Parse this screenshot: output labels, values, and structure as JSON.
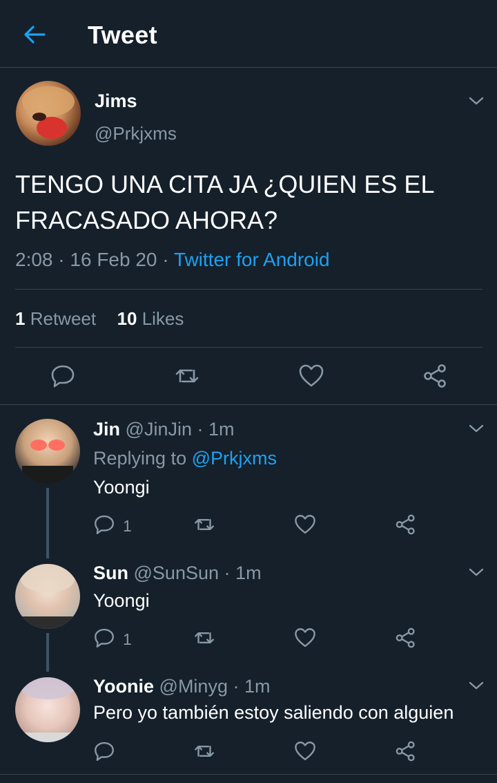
{
  "header": {
    "title": "Tweet",
    "back_icon": "back-arrow-icon"
  },
  "main_tweet": {
    "name": "Jims",
    "handle": "@Prkjxms",
    "text": "TENGO UNA CITA JA ¿QUIEN ES EL FRACASADO AHORA?",
    "time": "2:08",
    "date": "16 Feb 20",
    "source": "Twitter for Android",
    "retweet_count": "1",
    "retweet_label": "Retweet",
    "like_count": "10",
    "like_label": "Likes"
  },
  "replies": [
    {
      "name": "Jin",
      "handle": "@JinJin",
      "time": "1m",
      "replying_prefix": "Replying to",
      "replying_handle": "@Prkjxms",
      "text": "Yoongi",
      "reply_count": "1"
    },
    {
      "name": "Sun",
      "handle": "@SunSun",
      "time": "1m",
      "text": "Yoongi",
      "reply_count": "1"
    },
    {
      "name": "Yoonie",
      "handle": "@Minyg",
      "time": "1m",
      "text": "Pero yo también estoy saliendo con alguien"
    }
  ],
  "separator": "·",
  "colors": {
    "background": "#15202b",
    "accent": "#1da1f2",
    "secondary_text": "#8899a6",
    "divider": "#38444d",
    "thread_line": "#3d5466"
  }
}
